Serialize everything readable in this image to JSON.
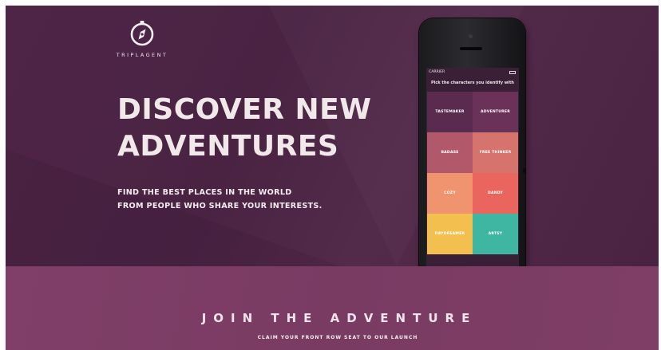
{
  "brand": {
    "name": "TRIPLAGENT",
    "logo_icon": "compass-icon"
  },
  "hero": {
    "headline_line1": "DISCOVER NEW",
    "headline_line2": "ADVENTURES",
    "sub_line1": "FIND THE BEST PLACES IN THE WORLD",
    "sub_line2": "FROM PEOPLE WHO SHARE YOUR INTERESTS."
  },
  "phone": {
    "carrier": "CARRIER",
    "prompt": "Pick the characters you identify with",
    "tiles": [
      {
        "label": "TASTEMAKER",
        "color": "#5a2a4f"
      },
      {
        "label": "ADVENTURER",
        "color": "#6a3258"
      },
      {
        "label": "BADASS",
        "color": "#b2586b"
      },
      {
        "label": "FREE THINKER",
        "color": "#d7736d"
      },
      {
        "label": "COZY",
        "color": "#f0946f"
      },
      {
        "label": "DANDY",
        "color": "#e9655e"
      },
      {
        "label": "DAYDREAMER",
        "color": "#f3c050"
      },
      {
        "label": "ARTSY",
        "color": "#3fb6a1"
      }
    ]
  },
  "cta": {
    "title": "JOIN THE ADVENTURE",
    "subtitle": "CLAIM YOUR FRONT ROW SEAT TO OUR LAUNCH"
  },
  "colors": {
    "hero_bg": "#4f2547",
    "cta_bg": "#7f3f68",
    "text_light": "#f1e8ea"
  }
}
